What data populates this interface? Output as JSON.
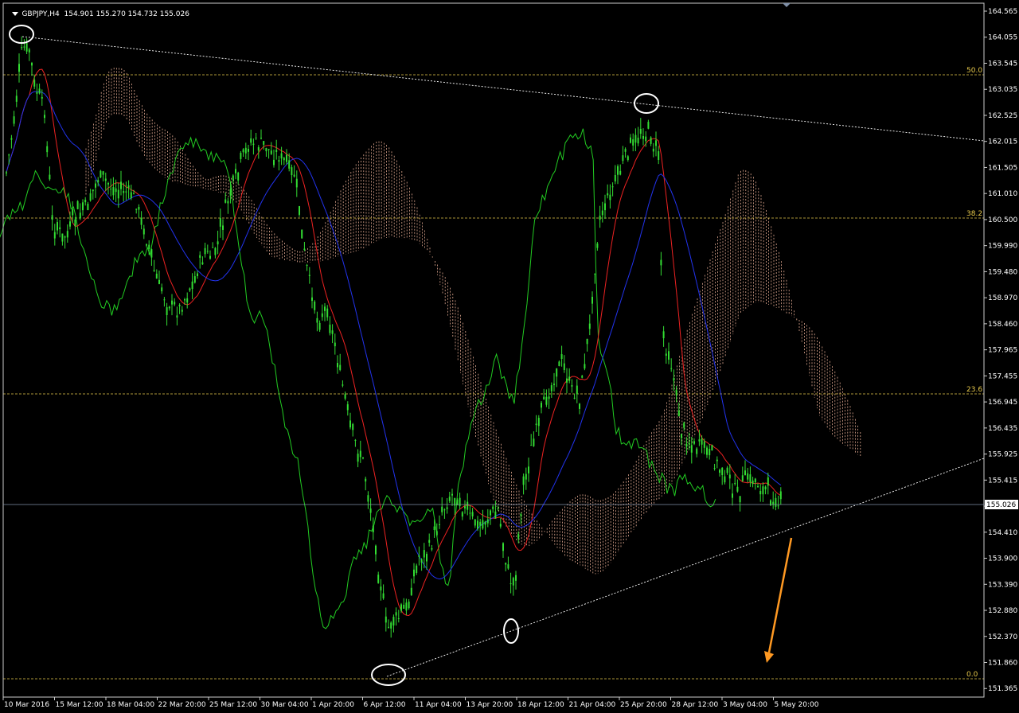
{
  "header": {
    "symbol_tf": "GBPJPY,H4",
    "ohlc": "154.901 155.270 154.732 155.026"
  },
  "price_axis": {
    "ticks": [
      "164.565",
      "164.055",
      "163.545",
      "163.035",
      "162.525",
      "162.015",
      "161.505",
      "161.010",
      "160.500",
      "159.990",
      "159.480",
      "158.970",
      "158.460",
      "157.965",
      "157.455",
      "156.945",
      "156.435",
      "155.925",
      "155.415",
      "154.905",
      "154.410",
      "153.900",
      "153.390",
      "152.880",
      "152.370",
      "151.860",
      "151.365"
    ],
    "current_price": "155.026",
    "current_price_color": "#ffffff"
  },
  "time_axis": {
    "labels": [
      "10 Mar 2016",
      "15 Mar 12:00",
      "18 Mar 04:00",
      "22 Mar 20:00",
      "25 Mar 12:00",
      "30 Mar 04:00",
      "1 Apr 20:00",
      "6 Apr 12:00",
      "11 Apr 04:00",
      "13 Apr 20:00",
      "18 Apr 12:00",
      "21 Apr 04:00",
      "25 Apr 20:00",
      "28 Apr 12:00",
      "3 May 04:00",
      "5 May 20:00"
    ]
  },
  "fib_levels": [
    {
      "label": "50.0"
    },
    {
      "label": "38.2"
    },
    {
      "label": "23.6"
    },
    {
      "label": "0.0"
    }
  ],
  "colors": {
    "background": "#000000",
    "candles": "#33dd33",
    "chikou": "#22cc22",
    "tenkan": "#ee2222",
    "kijun": "#2233ee",
    "cloud": "#e0a890",
    "fib": "#e6c84a",
    "trendline": "#ffffff",
    "arrow": "#ff9922",
    "circle": "#ffffff"
  },
  "annotations": {
    "arrow_direction": "down",
    "circled_points": 4
  }
}
